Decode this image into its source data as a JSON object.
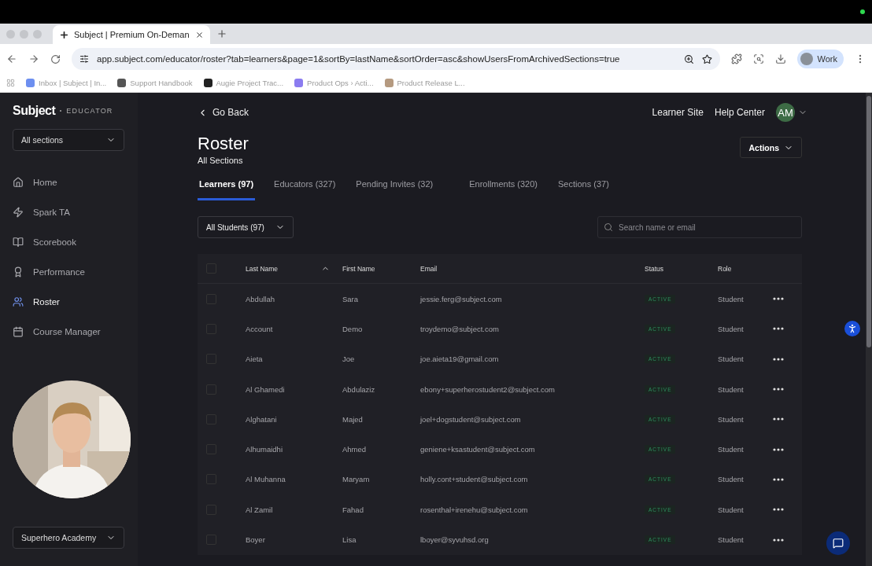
{
  "browser": {
    "tab_title": "Subject | Premium On-Deman",
    "url": "app.subject.com/educator/roster?tab=learners&page=1&sortBy=lastName&sortOrder=asc&showUsersFromArchivedSections=true",
    "profile": "Work",
    "bookmarks": [
      {
        "label": "Inbox | Subject | In...",
        "color": "#6d8ff0"
      },
      {
        "label": "Support Handbook",
        "color": "#555555"
      },
      {
        "label": "Augie Project Trac...",
        "color": "#222222"
      },
      {
        "label": "Product Ops › Acti...",
        "color": "#8b7cf0"
      },
      {
        "label": "Product Release L...",
        "color": "#b59a80"
      }
    ]
  },
  "sidebar": {
    "logo": "Subject",
    "product": "EDUCATOR",
    "section_select": "All sections",
    "items": [
      {
        "label": "Home",
        "selected": false
      },
      {
        "label": "Spark TA",
        "selected": false
      },
      {
        "label": "Scorebook",
        "selected": false
      },
      {
        "label": "Performance",
        "selected": false
      },
      {
        "label": "Roster",
        "selected": true
      },
      {
        "label": "Course Manager",
        "selected": false
      }
    ],
    "org_select": "Superhero Academy"
  },
  "header": {
    "back": "Go Back",
    "links": [
      "Learner Site",
      "Help Center"
    ],
    "avatar": "AM"
  },
  "page": {
    "title": "Roster",
    "subtitle": "All Sections",
    "actions": "Actions"
  },
  "tabs": [
    {
      "label": "Learners (97)",
      "selected": true
    },
    {
      "label": "Educators (327)",
      "selected": false
    },
    {
      "label": "Pending Invites (32)",
      "selected": false
    },
    {
      "label": "Enrollments (320)",
      "selected": false
    },
    {
      "label": "Sections (37)",
      "selected": false
    }
  ],
  "filter": "All Students (97)",
  "search": {
    "placeholder": "Search name or email"
  },
  "table": {
    "all_checked": false,
    "columns": [
      {
        "label": "Last Name",
        "sorted": true
      },
      {
        "label": "First Name",
        "sorted": false
      },
      {
        "label": "Email",
        "sorted": false
      },
      {
        "label": "Status",
        "sorted": false
      },
      {
        "label": "Role",
        "sorted": false
      }
    ],
    "rows": [
      {
        "checked": false,
        "last": "Abdullah",
        "first": "Sara",
        "email": "jessie.ferg@subject.com",
        "status": "ACTIVE",
        "role": "Student"
      },
      {
        "checked": false,
        "last": "Account",
        "first": "Demo",
        "email": "troydemo@subject.com",
        "status": "ACTIVE",
        "role": "Student"
      },
      {
        "checked": false,
        "last": "Aieta",
        "first": "Joe",
        "email": "joe.aieta19@gmail.com",
        "status": "ACTIVE",
        "role": "Student"
      },
      {
        "checked": false,
        "last": "Al Ghamedi",
        "first": "Abdulaziz",
        "email": "ebony+superherostudent2@subject.com",
        "status": "ACTIVE",
        "role": "Student"
      },
      {
        "checked": false,
        "last": "Alghatani",
        "first": "Majed",
        "email": "joel+dogstudent@subject.com",
        "status": "ACTIVE",
        "role": "Student"
      },
      {
        "checked": false,
        "last": "Alhumaidhi",
        "first": "Ahmed",
        "email": "geniene+ksastudent@subject.com",
        "status": "ACTIVE",
        "role": "Student"
      },
      {
        "checked": false,
        "last": "Al Muhanna",
        "first": "Maryam",
        "email": "holly.cont+student@subject.com",
        "status": "ACTIVE",
        "role": "Student"
      },
      {
        "checked": false,
        "last": "Al Zamil",
        "first": "Fahad",
        "email": "rosenthal+irenehu@subject.com",
        "status": "ACTIVE",
        "role": "Student"
      },
      {
        "checked": false,
        "last": "Boyer",
        "first": "Lisa",
        "email": "lboyer@syvuhsd.org",
        "status": "ACTIVE",
        "role": "Student"
      }
    ]
  }
}
